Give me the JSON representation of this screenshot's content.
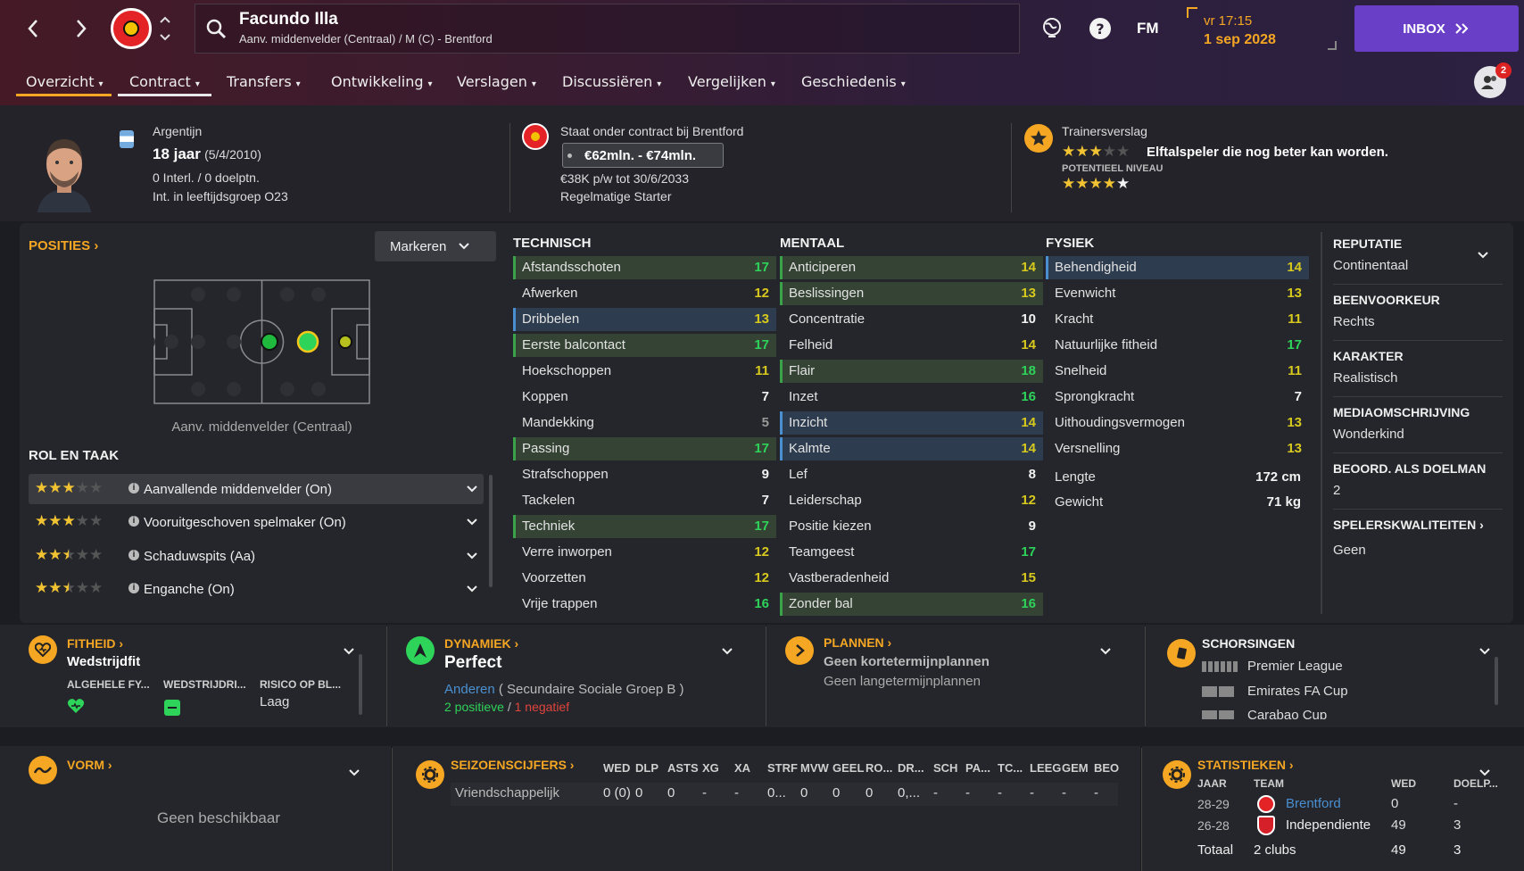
{
  "nav": {
    "back": "‹",
    "forward": "›"
  },
  "player": {
    "name": "Facundo Illa",
    "subtitle": "Aanv. middenvelder (Centraal) / M (C) - Brentford"
  },
  "topbar": {
    "fm_label": "FM",
    "time": "vr 17:15",
    "date": "1 sep 2028",
    "inbox_label": "INBOX",
    "notif_count": "2"
  },
  "tabs": [
    {
      "label": "Overzicht"
    },
    {
      "label": "Contract"
    },
    {
      "label": "Transfers"
    },
    {
      "label": "Ontwikkeling"
    },
    {
      "label": "Verslagen"
    },
    {
      "label": "Discussiëren"
    },
    {
      "label": "Vergelijken"
    },
    {
      "label": "Geschiedenis"
    }
  ],
  "header": {
    "nationality": "Argentijn",
    "age": "18 jaar",
    "dob": "(5/4/2010)",
    "caps": "0 Interl. / 0 doelptn.",
    "youth": "Int. in leeftijdsgroep O23",
    "contract_title": "Staat onder contract bij Brentford",
    "value_range": "€62mln. - €74mln.",
    "wage": "€38K p/w tot 30/6/2033",
    "status": "Regelmatige Starter",
    "report_title": "Trainersverslag",
    "report_text": "Elftalspeler die nog beter kan worden.",
    "potential_label": "POTENTIEEL NIVEAU",
    "current_stars": 3,
    "potential_stars": 4.5
  },
  "positions": {
    "title": "POSITIES",
    "mark_button": "Markeren",
    "position_name": "Aanv. middenvelder (Centraal)"
  },
  "roles": {
    "title": "ROL EN TAAK",
    "items": [
      {
        "label": "Aanvallende middenvelder (On)",
        "stars": 3
      },
      {
        "label": "Vooruitgeschoven spelmaker (On)",
        "stars": 3
      },
      {
        "label": "Schaduwspits (Aa)",
        "stars": 2.5
      },
      {
        "label": "Enganche (On)",
        "stars": 2.5
      }
    ]
  },
  "technical": {
    "title": "TECHNISCH",
    "items": [
      {
        "name": "Afstandsschoten",
        "value": "17"
      },
      {
        "name": "Afwerken",
        "value": "12"
      },
      {
        "name": "Dribbelen",
        "value": "13"
      },
      {
        "name": "Eerste balcontact",
        "value": "17"
      },
      {
        "name": "Hoekschoppen",
        "value": "11"
      },
      {
        "name": "Koppen",
        "value": "7"
      },
      {
        "name": "Mandekking",
        "value": "5"
      },
      {
        "name": "Passing",
        "value": "17"
      },
      {
        "name": "Strafschoppen",
        "value": "9"
      },
      {
        "name": "Tackelen",
        "value": "7"
      },
      {
        "name": "Techniek",
        "value": "17"
      },
      {
        "name": "Verre inworpen",
        "value": "12"
      },
      {
        "name": "Voorzetten",
        "value": "12"
      },
      {
        "name": "Vrije trappen",
        "value": "16"
      }
    ]
  },
  "mental": {
    "title": "MENTAAL",
    "items": [
      {
        "name": "Anticiperen",
        "value": "14"
      },
      {
        "name": "Beslissingen",
        "value": "13"
      },
      {
        "name": "Concentratie",
        "value": "10"
      },
      {
        "name": "Felheid",
        "value": "14"
      },
      {
        "name": "Flair",
        "value": "18"
      },
      {
        "name": "Inzet",
        "value": "16"
      },
      {
        "name": "Inzicht",
        "value": "14"
      },
      {
        "name": "Kalmte",
        "value": "14"
      },
      {
        "name": "Lef",
        "value": "8"
      },
      {
        "name": "Leiderschap",
        "value": "12"
      },
      {
        "name": "Positie kiezen",
        "value": "9"
      },
      {
        "name": "Teamgeest",
        "value": "17"
      },
      {
        "name": "Vastberadenheid",
        "value": "15"
      },
      {
        "name": "Zonder bal",
        "value": "16"
      }
    ]
  },
  "physical": {
    "title": "FYSIEK",
    "items": [
      {
        "name": "Behendigheid",
        "value": "14"
      },
      {
        "name": "Evenwicht",
        "value": "13"
      },
      {
        "name": "Kracht",
        "value": "11"
      },
      {
        "name": "Natuurlijke fitheid",
        "value": "17"
      },
      {
        "name": "Snelheid",
        "value": "11"
      },
      {
        "name": "Sprongkracht",
        "value": "7"
      },
      {
        "name": "Uithoudingsvermogen",
        "value": "13"
      },
      {
        "name": "Versnelling",
        "value": "13"
      }
    ],
    "height_label": "Lengte",
    "height": "172 cm",
    "weight_label": "Gewicht",
    "weight": "71 kg"
  },
  "side": {
    "items": [
      {
        "label": "REPUTATIE",
        "value": "Continentaal"
      },
      {
        "label": "BEENVOORKEUR",
        "value": "Rechts"
      },
      {
        "label": "KARAKTER",
        "value": "Realistisch"
      },
      {
        "label": "MEDIAOMSCHRIJVING",
        "value": "Wonderkind"
      },
      {
        "label": "BEOORD. ALS DOELMAN",
        "value": "2"
      },
      {
        "label": "SPELERSKWALITEITEN",
        "value": "Geen"
      }
    ]
  },
  "fitness": {
    "title": "FITHEID",
    "status": "Wedstrijdfit",
    "col1": "ALGEHELE FY...",
    "col2": "WEDSTRIJDRI...",
    "col3": "RISICO OP BL...",
    "risk": "Laag"
  },
  "dynamics": {
    "title": "DYNAMIEK",
    "status": "Perfect",
    "group_link": "Anderen",
    "group_text": "( Secundaire Sociale Groep B )",
    "positive": "2 positieve",
    "sep": "/",
    "negative": "1 negatief"
  },
  "plans": {
    "title": "PLANNEN",
    "short": "Geen kortetermijnplannen",
    "long": "Geen langetermijnplannen"
  },
  "suspensions": {
    "title": "SCHORSINGEN",
    "items": [
      "Premier League",
      "Emirates FA Cup",
      "Carabao Cup"
    ]
  },
  "form": {
    "title": "VORM",
    "empty": "Geen beschikbaar"
  },
  "season": {
    "title": "SEIZOENSCIJFERS",
    "headers": [
      "WED",
      "DLP",
      "ASTS",
      "XG",
      "XA",
      "STRF",
      "MVW",
      "GEEL",
      "RO...",
      "DR...",
      "SCH",
      "PA...",
      "TC...",
      "LEEG",
      "GEM",
      "BEO"
    ],
    "row_label": "Vriendschappelijk",
    "row": [
      "0 (0)",
      "0",
      "0",
      "-",
      "-",
      "0...",
      "0",
      "0",
      "0",
      "0,...",
      "-",
      "-",
      "-",
      "-",
      "-",
      "-"
    ]
  },
  "stats": {
    "title": "STATISTIEKEN",
    "headers": [
      "JAAR",
      "TEAM",
      "WED",
      "DOELP..."
    ],
    "rows": [
      {
        "year": "28-29",
        "team": "Brentford",
        "apps": "0",
        "goals": "-"
      },
      {
        "year": "26-28",
        "team": "Independiente",
        "apps": "49",
        "goals": "3"
      }
    ],
    "total_label": "Totaal",
    "total_team": "2 clubs",
    "total_apps": "49",
    "total_goals": "3"
  },
  "colors": {
    "accent": "#f5a623",
    "inbox": "#6a3fc8",
    "green": "#2ed35a",
    "yellow": "#d7c91d",
    "link": "#4a8fd0"
  }
}
